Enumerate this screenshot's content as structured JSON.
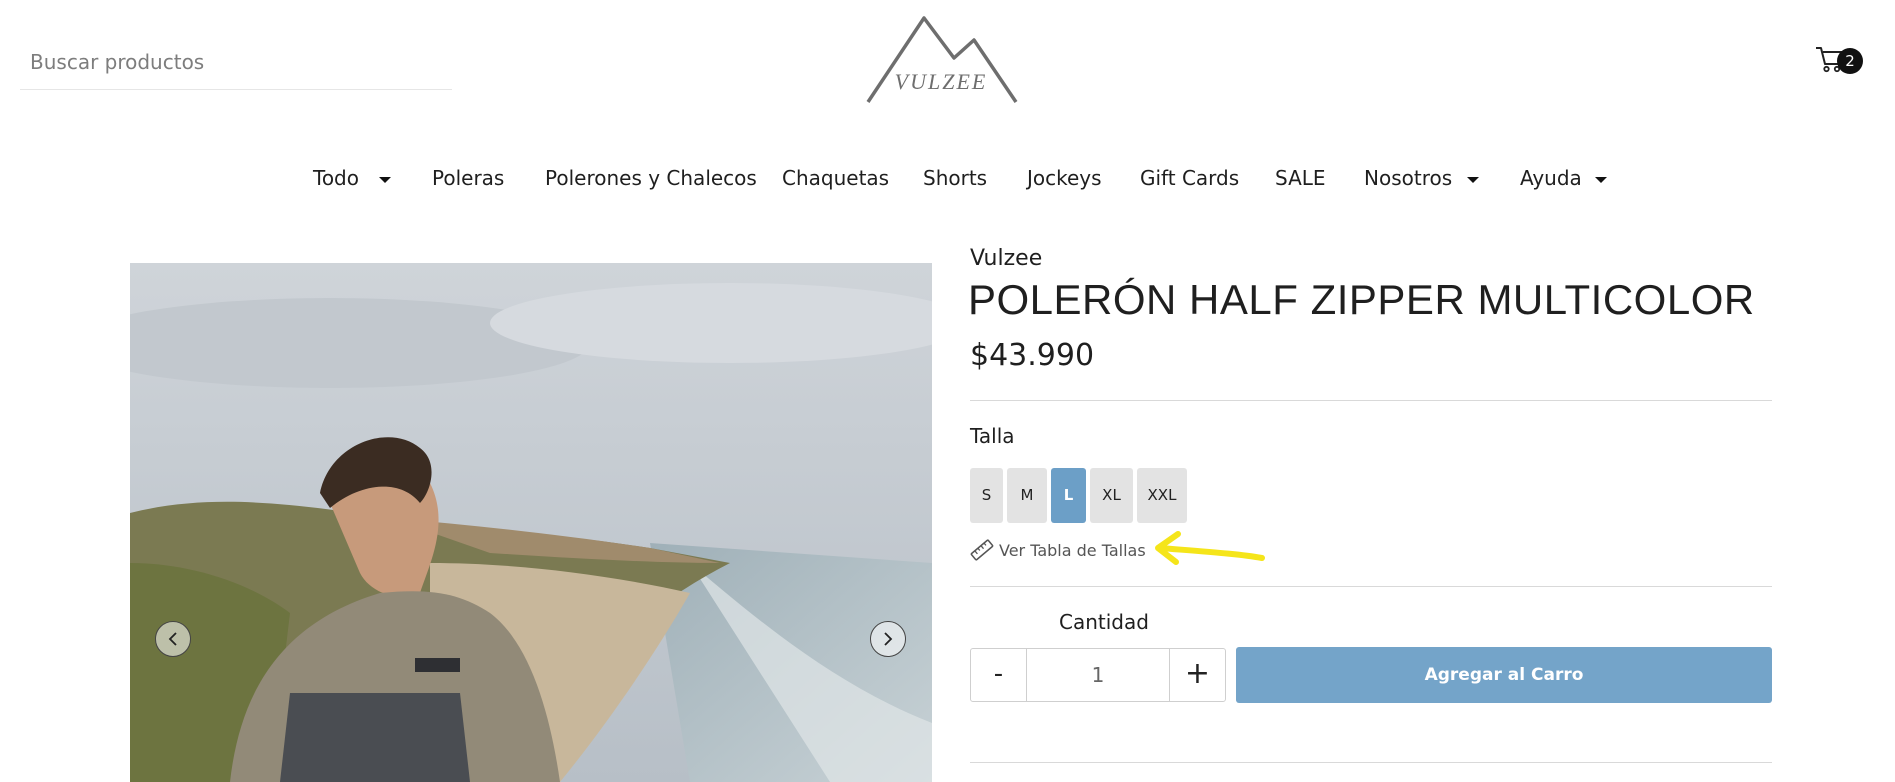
{
  "header": {
    "search_placeholder": "Buscar productos",
    "logo_text": "VULZEE",
    "cart_count": "2"
  },
  "nav": {
    "items": [
      {
        "label": "Todo",
        "dropdown": true
      },
      {
        "label": "Poleras",
        "dropdown": false
      },
      {
        "label": "Polerones y Chalecos",
        "dropdown": false
      },
      {
        "label": "Chaquetas",
        "dropdown": false
      },
      {
        "label": "Shorts",
        "dropdown": false
      },
      {
        "label": "Jockeys",
        "dropdown": false
      },
      {
        "label": "Gift Cards",
        "dropdown": false
      },
      {
        "label": "SALE",
        "dropdown": false
      },
      {
        "label": "Nosotros",
        "dropdown": true
      },
      {
        "label": "Ayuda",
        "dropdown": true
      }
    ]
  },
  "product": {
    "brand": "Vulzee",
    "title": "POLERÓN HALF ZIPPER MULTICOLOR",
    "price": "$43.990",
    "size_label": "Talla",
    "sizes": [
      "S",
      "M",
      "L",
      "XL",
      "XXL"
    ],
    "selected_size": "L",
    "size_chart_link": "Ver Tabla de Tallas",
    "quantity_label": "Cantidad",
    "quantity_value": "1",
    "minus_label": "-",
    "plus_label": "+",
    "add_to_cart_label": "Agregar al Carro"
  },
  "icons": {
    "search": "none",
    "cart": "cart-icon",
    "ruler": "ruler-icon",
    "prev": "chevron-left-icon",
    "next": "chevron-right-icon"
  },
  "colors": {
    "accent": "#74a4c9",
    "size_active": "#6c9fc7",
    "size_inactive": "#e3e3e3",
    "annotation": "#f5e51a"
  }
}
